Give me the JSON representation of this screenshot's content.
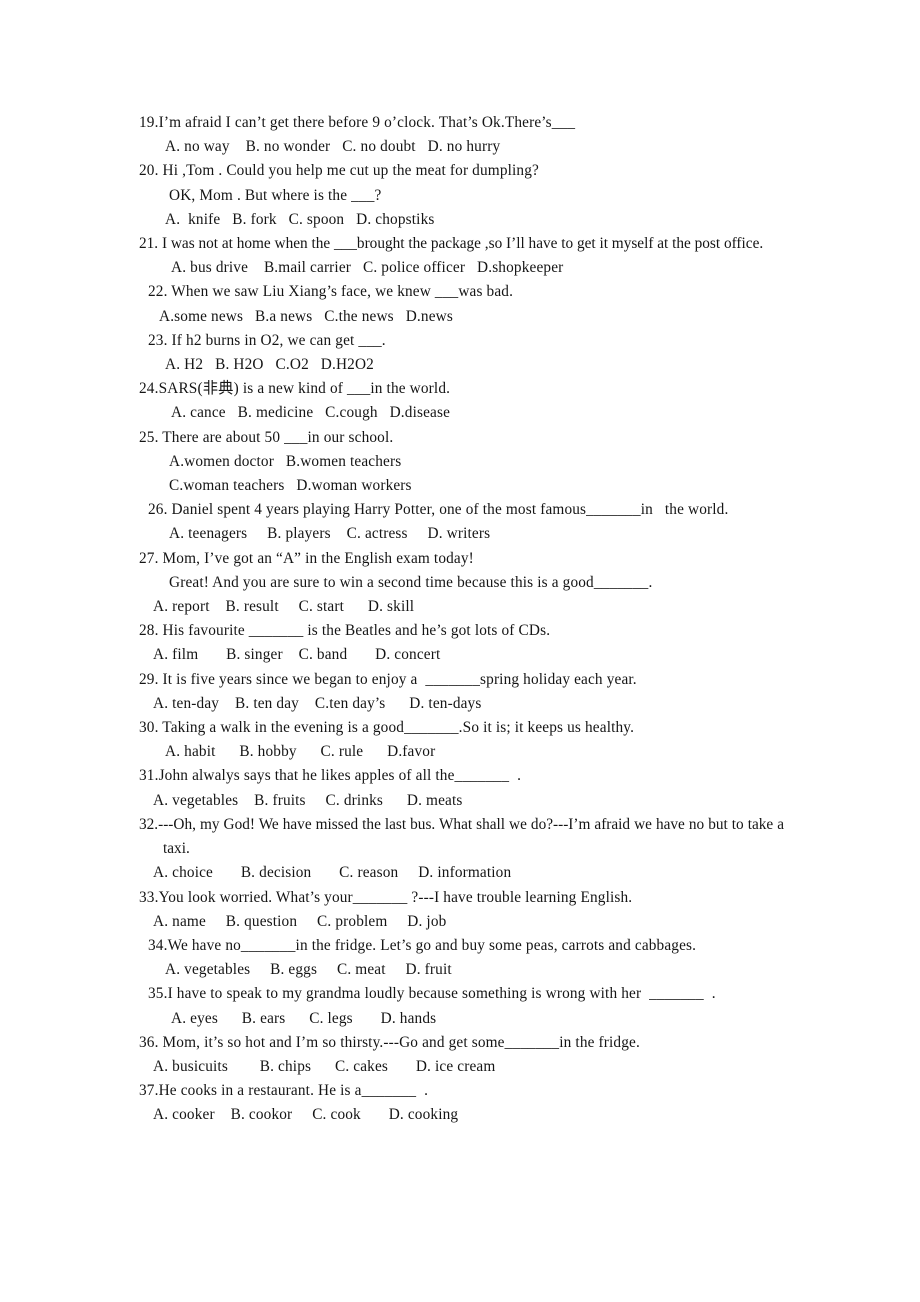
{
  "document": {
    "type": "english-multiple-choice-worksheet",
    "background_color": "#ffffff",
    "text_color": "#151515"
  },
  "questions": [
    {
      "number": "19",
      "stem": "19.I’m afraid I can’t get there before 9 o’clock. That’s Ok.There’s___",
      "options_lines": [
        "A. no way    B. no wonder   C. no doubt   D. no hurry"
      ]
    },
    {
      "number": "20",
      "stem": "20. Hi ,Tom . Could you help me cut up the meat for dumpling?",
      "stem_continuation": "OK, Mom . But where is the ___?",
      "options_lines": [
        "A.  knife   B. fork   C. spoon   D. chopstiks"
      ]
    },
    {
      "number": "21",
      "stem": "21. I was not at home when the ___brought the package ,so I’ll have to get it myself at the post office.",
      "options_lines": [
        "A. bus drive    B.mail carrier   C. police officer   D.shopkeeper"
      ]
    },
    {
      "number": "22",
      "stem": "22. When we saw Liu Xiang’s face, we knew ___was bad.",
      "options_lines": [
        "A.some news   B.a news   C.the news   D.news"
      ]
    },
    {
      "number": "23",
      "stem": "23. If h2 burns in O2, we can get ___.",
      "options_lines": [
        "A. H2   B. H2O   C.O2   D.H2O2"
      ]
    },
    {
      "number": "24",
      "stem": "24.SARS(非典) is a new kind of ___in the world.",
      "options_lines": [
        "A. cance   B. medicine   C.cough   D.disease"
      ]
    },
    {
      "number": "25",
      "stem": "25. There are about 50 ___in our school.",
      "options_lines": [
        "A.women doctor   B.women teachers",
        "C.woman teachers   D.woman workers"
      ]
    },
    {
      "number": "26",
      "stem": "26. Daniel spent 4 years playing Harry Potter, one of the most famous_______in   the world.",
      "options_lines": [
        "A. teenagers     B. players    C. actress     D. writers"
      ]
    },
    {
      "number": "27",
      "stem": "27. Mom, I’ve got an “A” in the English exam today!",
      "stem_continuation": "Great! And you are sure to win a  second time because this is a good_______.",
      "options_lines": [
        "A. report    B. result     C. start      D. skill"
      ]
    },
    {
      "number": "28",
      "stem": "28. His favourite _______ is the Beatles and he’s got lots of CDs.",
      "options_lines": [
        "A. film       B. singer    C. band       D. concert"
      ]
    },
    {
      "number": "29",
      "stem": "29. It is five years since we began to enjoy a  _______spring holiday each year.",
      "options_lines": [
        "A. ten-day    B. ten day    C.ten day’s      D. ten-days"
      ]
    },
    {
      "number": "30",
      "stem": "30. Taking a walk in the evening is a good_______.So it is; it keeps us healthy.",
      "options_lines": [
        "A. habit      B. hobby      C. rule      D.favor"
      ]
    },
    {
      "number": "31",
      "stem": "31.John alwalys says that he likes apples of all the_______  .",
      "options_lines": [
        "A. vegetables    B. fruits     C. drinks      D. meats"
      ]
    },
    {
      "number": "32",
      "stem": "32.---Oh, my God! We have missed the last bus. What shall we do?---I’m afraid we have no but to take a taxi.",
      "options_lines": [
        "A. choice       B. decision       C. reason     D. information"
      ]
    },
    {
      "number": "33",
      "stem": "33.You look worried. What’s your_______ ?---I have trouble learning English.",
      "options_lines": [
        "A. name     B. question     C. problem     D. job"
      ]
    },
    {
      "number": "34",
      "stem": "34.We have no_______in the fridge. Let’s go and buy some peas, carrots and cabbages.",
      "options_lines": [
        "A. vegetables     B. eggs     C. meat     D. fruit"
      ]
    },
    {
      "number": "35",
      "stem": "35.I have to speak to my grandma loudly because something is wrong with her  _______  .",
      "options_lines": [
        "A. eyes      B. ears      C. legs       D. hands"
      ]
    },
    {
      "number": "36",
      "stem": "36. Mom, it’s so hot and I’m so thirsty.---Go and get some_______in the fridge.",
      "options_lines": [
        "A. busicuits        B. chips      C. cakes       D. ice cream"
      ]
    },
    {
      "number": "37",
      "stem": "37.He cooks in a restaurant. He is a_______  .",
      "options_lines": [
        "A. cooker    B. cookor     C. cook       D. cooking"
      ]
    }
  ]
}
